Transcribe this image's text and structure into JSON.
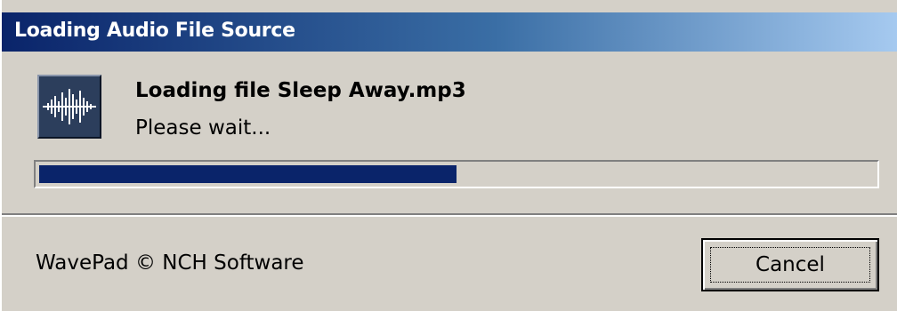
{
  "window": {
    "title": "Loading Audio File Source"
  },
  "content": {
    "icon": "waveform-icon",
    "message": "Loading file Sleep Away.mp3",
    "submessage": "Please wait..."
  },
  "progress": {
    "fraction": 0.5
  },
  "footer": {
    "copyright": "WavePad © NCH Software",
    "cancel_label": "Cancel"
  },
  "colors": {
    "title_gradient_start": "#0a246a",
    "title_gradient_end": "#a6caf0",
    "progress_fill": "#0a246a",
    "dialog_face": "#d4d0c8"
  }
}
